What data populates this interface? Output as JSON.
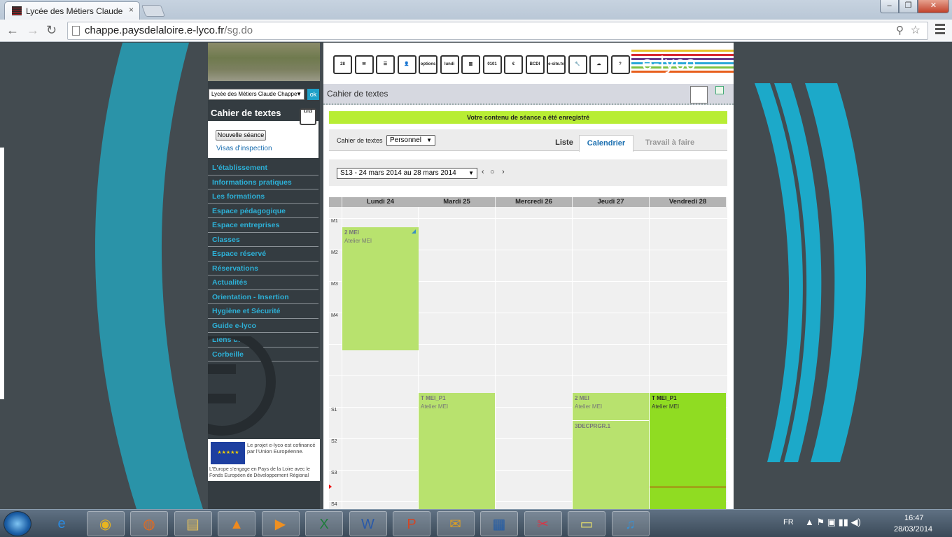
{
  "browser": {
    "tab_title": "Lycée des Métiers Claude",
    "tab_close": "×",
    "url_host": "chappe.paysdelaloire.e-lyco.fr",
    "url_path": "/sg.do",
    "window_controls": {
      "minimize": "–",
      "maximize": "❐",
      "close": "✕"
    }
  },
  "sidebar": {
    "school_select": "Lycée des Métiers Claude Chappe",
    "ok_label": "ok",
    "section_title": "Cahier de textes",
    "new_session_label": "Nouvelle séance",
    "visas_label": "Visas d'inspection",
    "nav_items": [
      "L'établissement",
      "Informations pratiques",
      "Les formations",
      "Espace pédagogique",
      "Espace entreprises",
      "Classes",
      "Espace réservé",
      "Réservations",
      "Actualités",
      "Orientation - Insertion",
      "Hygiène et Sécurité",
      "Guide e-lyco",
      "Liens utiles",
      "Corbeille"
    ],
    "eu_text": "Le projet e-lyco est cofinancé par l'Union Européenne.",
    "eu_footer": "L'Europe s'engage en Pays de la Loire avec le Fonds Européen de Développement Régional"
  },
  "banner": {
    "icons": [
      "28",
      "✉",
      "☰",
      "👤",
      "options",
      "lundi",
      "▥",
      "0101",
      "€",
      "BCDI",
      "e-site.tv",
      "🔧",
      "☁",
      "?"
    ],
    "brand": "e-lyco",
    "stripe_colors": [
      "#e8c12c",
      "#d8262f",
      "#6a3c8c",
      "#2aa8d8",
      "#7dc242",
      "#e85f1c"
    ]
  },
  "main": {
    "title": "Cahier de textes",
    "success_message": "Votre contenu de séance a été enregistré",
    "notebook_label": "Cahier de textes",
    "notebook_value": "Personnel",
    "tabs": {
      "list": "Liste",
      "calendar": "Calendrier",
      "todo": "Travail à faire"
    },
    "week_value": "S13 - 24 mars 2014 au 28 mars 2014",
    "nav_prev": "‹",
    "nav_today": "○",
    "nav_next": "›"
  },
  "calendar": {
    "days": [
      "Lundi 24",
      "Mardi 25",
      "Mercredi 26",
      "Jeudi 27",
      "Vendredi 28"
    ],
    "slot_labels": [
      "M1",
      "M2",
      "M3",
      "M4",
      "S1",
      "S2",
      "S3",
      "S4"
    ],
    "events": [
      {
        "day": 0,
        "group": "2 MEI",
        "subject": "Atelier MEI",
        "color": "#b8e26e"
      },
      {
        "day": 1,
        "group": "T MEI_P1",
        "subject": "Atelier MEI",
        "color": "#b8e26e"
      },
      {
        "day": 3,
        "group": "2 MEI",
        "subject": "Atelier MEI",
        "color": "#b8e26e"
      },
      {
        "day": 3,
        "group": "3DECPRGR.1",
        "subject": "",
        "color": "#b8e26e"
      },
      {
        "day": 4,
        "group": "T MEI_P1",
        "subject": "Atelier MEI",
        "color": "#90dc22"
      }
    ]
  },
  "taskbar": {
    "apps": [
      "ie",
      "chrome",
      "firefox",
      "explorer",
      "vlc",
      "media",
      "excel",
      "word",
      "powerpoint",
      "outlook",
      "publisher",
      "snipping",
      "sticky",
      "itunes"
    ],
    "lang": "FR",
    "time": "16:47",
    "date": "28/03/2014"
  }
}
